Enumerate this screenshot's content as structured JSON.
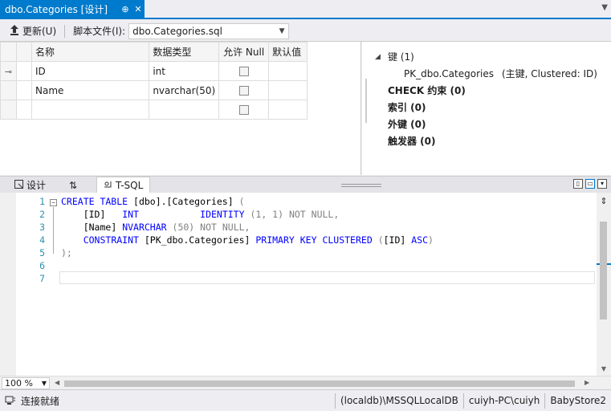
{
  "tab": {
    "title": "dbo.Categories [设计]",
    "pin": "⊕",
    "close": "✕"
  },
  "toolbar": {
    "update_label": "更新(U)",
    "script_file_label": "脚本文件(I):",
    "script_file_value": "dbo.Categories.sql"
  },
  "grid": {
    "headers": [
      "名称",
      "数据类型",
      "允许 Null",
      "默认值"
    ],
    "rows": [
      {
        "name": "ID",
        "type": "int",
        "allow_null": false,
        "is_key": true
      },
      {
        "name": "Name",
        "type": "nvarchar(50)",
        "allow_null": false,
        "is_key": false
      },
      {
        "name": "",
        "type": "",
        "allow_null": false,
        "is_key": false
      }
    ]
  },
  "properties": {
    "keys_label": "键 (1)",
    "pk_name": "PK_dbo.Categories",
    "pk_desc": "(主键, Clustered: ID)",
    "check_label": "CHECK 约束 (0)",
    "index_label": "索引 (0)",
    "fk_label": "外键 (0)",
    "trigger_label": "触发器 (0)"
  },
  "panes": {
    "design": "设计",
    "swap": "⇅",
    "tsql": "T-SQL"
  },
  "editor": {
    "line_numbers": [
      "1",
      "2",
      "3",
      "4",
      "5",
      "6",
      "7"
    ],
    "sql": {
      "l1_kw": "CREATE TABLE",
      "l1_rest": " [dbo].[Categories] ",
      "l1_paren": "(",
      "l2_col": "[ID]",
      "l2_type": "INT",
      "l2_ident": "IDENTITY",
      "l2_args": "(1, 1)",
      "l2_nn": "NOT NULL",
      "l2_comma": ",",
      "l3_col": "[Name]",
      "l3_type": "NVARCHAR",
      "l3_args": "(50)",
      "l3_nn": "NOT NULL",
      "l3_comma": ",",
      "l4_kw": "CONSTRAINT",
      "l4_name": " [PK_dbo.Categories] ",
      "l4_pk": "PRIMARY KEY CLUSTERED",
      "l4_open": " (",
      "l4_col": "[ID]",
      "l4_asc": "ASC",
      "l4_close": ")",
      "l5": ");"
    }
  },
  "zoom": "100 %",
  "status": {
    "ready": "连接就绪",
    "server": "(localdb)\\MSSQLLocalDB",
    "user": "cuiyh-PC\\cuiyh",
    "db": "BabyStore2"
  }
}
